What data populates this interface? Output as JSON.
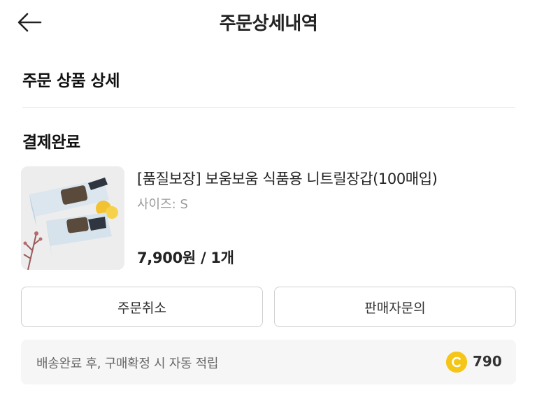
{
  "header": {
    "title": "주문상세내역",
    "back_icon": "arrow-left-icon"
  },
  "section": {
    "title": "주문 상품 상세"
  },
  "order": {
    "status": "결제완료",
    "product": {
      "name": "[품질보장] 보움보움 식품용 니트릴장갑(100매입)",
      "option": "사이즈: S",
      "price": "7,900원 / 1개"
    }
  },
  "buttons": {
    "cancel": "주문취소",
    "inquiry": "판매자문의"
  },
  "reward": {
    "text": "배송완료 후, 구매확정 시 자동 적립",
    "points": "790",
    "coin_icon": "coin-icon",
    "coin_color": "#f5c518"
  }
}
